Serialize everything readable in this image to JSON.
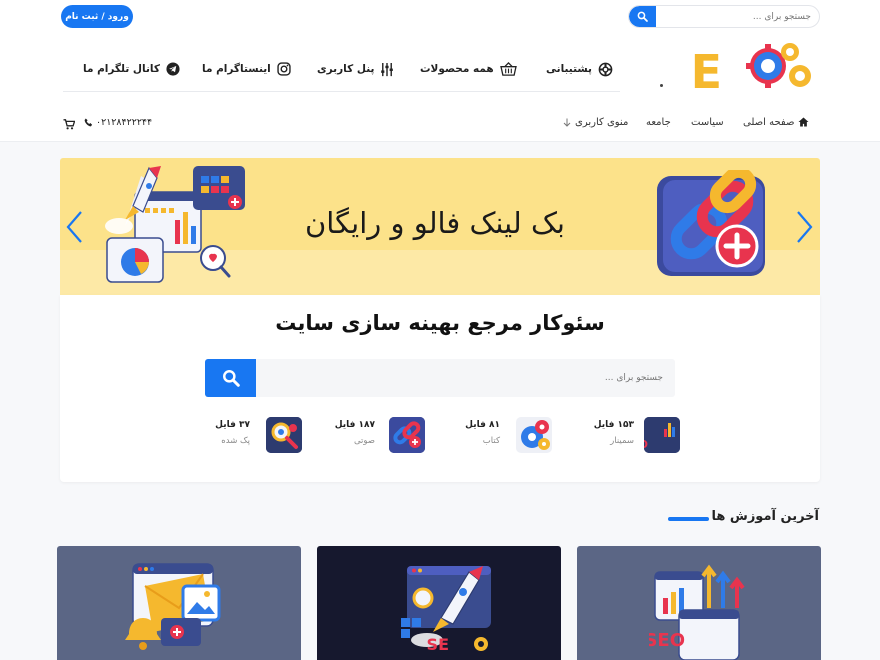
{
  "header": {
    "search_placeholder": "جستجو برای ...",
    "login_label": "ورود / ثبت نام",
    "logo_text": "SEO",
    "nav_top": [
      {
        "label": "پشتیبانی",
        "icon": "lifebuoy-icon"
      },
      {
        "label": "همه محصولات",
        "icon": "basket-icon"
      },
      {
        "label": "پنل کاربری",
        "icon": "sliders-icon"
      },
      {
        "label": "اینستاگرام ما",
        "icon": "instagram-icon"
      },
      {
        "label": "کانال تلگرام ما",
        "icon": "telegram-icon"
      }
    ],
    "nav_main": [
      {
        "label": "صفحه اصلی",
        "icon": "home-icon"
      },
      {
        "label": "سیاست"
      },
      {
        "label": "جامعه"
      },
      {
        "label": "منوی کاربری",
        "icon": "arrow-down-icon"
      }
    ],
    "phone": "۰۲۱۲۸۴۲۲۲۴۴"
  },
  "slider": {
    "title": "بک لینک فالو و رایگان"
  },
  "hero": {
    "title": "سئوکار مرجع بهینه سازی سایت",
    "search_placeholder": "جستجو برای ..."
  },
  "categories": [
    {
      "count": "۱۵۳ فایل",
      "name": "سمینار",
      "icon": "seo-chart-icon"
    },
    {
      "count": "۸۱ فایل",
      "name": "کتاب",
      "icon": "gears-icon"
    },
    {
      "count": "۱۸۷ فایل",
      "name": "صوتی",
      "icon": "chain-link-icon"
    },
    {
      "count": "۳۷ فایل",
      "name": "پک شده",
      "icon": "magnifier-gears-icon"
    }
  ],
  "latest": {
    "title": "آخرین آموزش ها",
    "cards": [
      {
        "bg": "#5b6685"
      },
      {
        "bg": "#16182e"
      },
      {
        "bg": "#5b6685"
      }
    ]
  },
  "colors": {
    "accent": "#1877f2",
    "slider_bg": "#fce28a",
    "logo_red": "#e8344e",
    "logo_yellow": "#f5b82e",
    "logo_blue": "#2f7be8"
  }
}
